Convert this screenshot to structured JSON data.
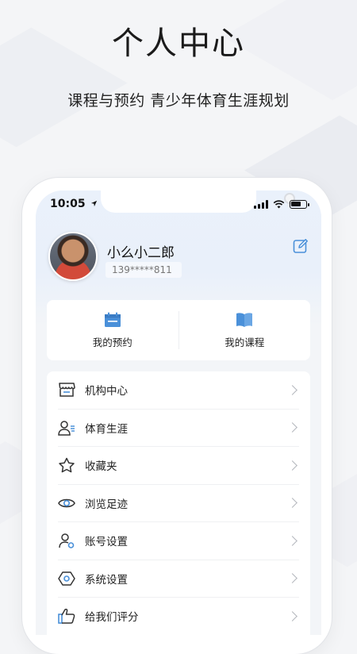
{
  "promo": {
    "headline": "个人中心",
    "subline": "课程与预约 青少年体育生涯规划"
  },
  "status_bar": {
    "time": "10:05"
  },
  "profile": {
    "name": "小么小二郎",
    "phone": "139*****811"
  },
  "quick_actions": [
    {
      "label": "我的预约",
      "icon": "calendar-icon"
    },
    {
      "label": "我的课程",
      "icon": "book-icon"
    }
  ],
  "menu": [
    {
      "label": "机构中心",
      "icon": "storefront-icon"
    },
    {
      "label": "体育生涯",
      "icon": "user-list-icon"
    },
    {
      "label": "收藏夹",
      "icon": "star-icon"
    },
    {
      "label": "浏览足迹",
      "icon": "eye-icon"
    },
    {
      "label": "账号设置",
      "icon": "user-settings-icon"
    },
    {
      "label": "系统设置",
      "icon": "hexagon-gear-icon"
    },
    {
      "label": "给我们评分",
      "icon": "thumbs-up-icon"
    }
  ],
  "colors": {
    "accent": "#4a90d9",
    "icon_stroke": "#333333"
  }
}
